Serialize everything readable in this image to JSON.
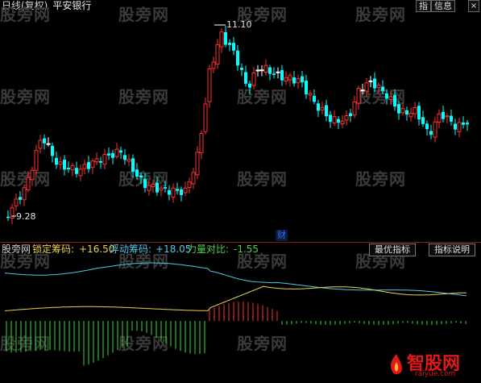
{
  "header": {
    "chart_mode": "日线(复权)",
    "stock_name": "平安银行",
    "btn_index": "指",
    "btn_info": "信息",
    "btn_close": "×"
  },
  "price_panel": {
    "high_label": "11.10",
    "low_label": "9.28",
    "marker": "财",
    "colors": {
      "up": "#ff3030",
      "down": "#00ffff",
      "cross": "#ffffff"
    }
  },
  "indicator": {
    "name": "股旁网",
    "lock_label": "锁定筹码:",
    "lock_value": "+16.50",
    "float_label": "浮动筹码:",
    "float_value": "+18.05",
    "ratio_label": "力量对比:",
    "ratio_value": "-1.55",
    "btn_best": "最优指标",
    "btn_help": "指标说明",
    "colors": {
      "lock": "#e8d44d",
      "float": "#4fc9e8",
      "pos": "#ff3030",
      "neg": "#30e030"
    }
  },
  "watermark": "股旁网",
  "logo": {
    "text": "智股网",
    "sub": "raiyue.com"
  }
}
